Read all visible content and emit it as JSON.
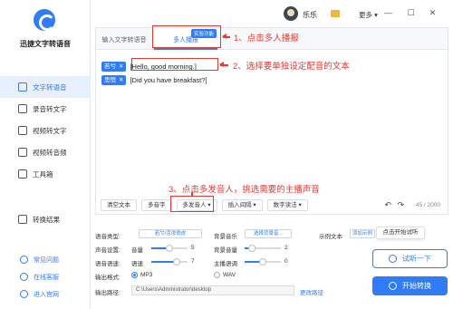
{
  "app": {
    "name": "迅捷文字转语音"
  },
  "sidebar": {
    "items": [
      {
        "label": "文字转语音",
        "icon": "text-to-speech-icon",
        "active": true
      },
      {
        "label": "录音转文字",
        "icon": "recording-icon",
        "active": false
      },
      {
        "label": "视频转文字",
        "icon": "video-icon",
        "active": false
      },
      {
        "label": "视频转音频",
        "icon": "video-audio-icon",
        "active": false
      },
      {
        "label": "工具箱",
        "icon": "toolbox-icon",
        "active": false
      },
      {
        "label": "转换结果",
        "icon": "result-icon",
        "active": false
      }
    ],
    "footer": [
      {
        "label": "常见问题",
        "icon": "question-icon"
      },
      {
        "label": "在线客服",
        "icon": "service-icon"
      },
      {
        "label": "进入官网",
        "icon": "website-icon"
      }
    ]
  },
  "topbar": {
    "username": "乐乐",
    "more": "更多"
  },
  "editor": {
    "tabs": [
      {
        "label": "输入文字转语音"
      },
      {
        "label": "多人播报"
      }
    ],
    "tab_badge": "实验功能",
    "lines": [
      {
        "speaker": "若兮",
        "text": "Hello, good morning."
      },
      {
        "speaker": "思恒",
        "text": "Did you have breakfast?"
      }
    ],
    "toolbar": {
      "clear": "清空文本",
      "polyphone": "多音字",
      "multi_speaker": "多发音人",
      "insert_pause": "插入间隔",
      "number_read": "数字读法"
    },
    "counter": "45 / 2000"
  },
  "annotations": {
    "step1": "1、点击多人播报",
    "step2": "2、选择要单独设定配音的文本",
    "step3": "3、点击多发音人，挑选需要的主播声音"
  },
  "settings": {
    "voice_type_label": "语音类型:",
    "voice_type_value": "若兮/活泼俏皮",
    "bg_music_label": "背景音乐",
    "bg_music_value": "选择背景音...",
    "sample_label": "示例文本",
    "sample_value": "添加示例",
    "volume_label": "声音设置:",
    "volume_name": "音量",
    "volume_value": "5",
    "bg_volume_name": "背景音量",
    "bg_volume_value": "2",
    "speed_label": "语音语速:",
    "speed_name": "语速",
    "speed_value": "7",
    "pitch_name": "主播语调",
    "pitch_value": "0",
    "format_label": "输出格式:",
    "format_mp3": "MP3",
    "format_wav": "WAV",
    "format_selected": "MP3",
    "path_label": "输出路径:",
    "path_value": "C:\\Users\\Administrator\\desktop",
    "change_path": "更改路径"
  },
  "actions": {
    "tooltip": "点击开始试听",
    "try_listen": "试听一下",
    "start": "开始转换"
  },
  "colors": {
    "accent": "#2f7cf6",
    "annotation": "#e53935"
  }
}
